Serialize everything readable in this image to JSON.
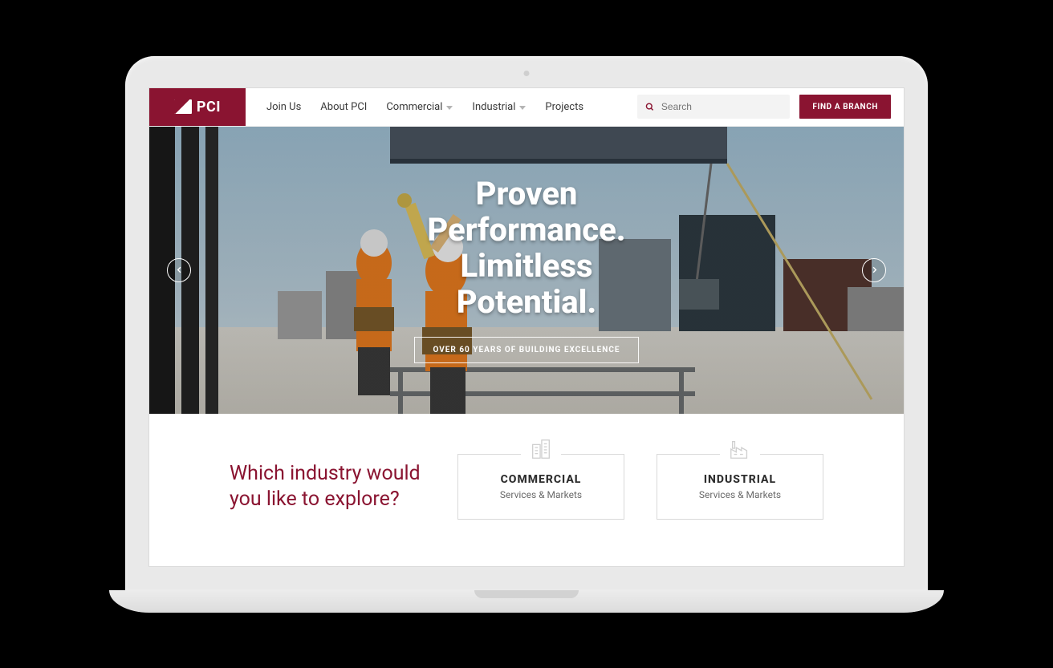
{
  "brand": {
    "name": "PCI"
  },
  "nav": {
    "items": [
      {
        "label": "Join Us",
        "dropdown": false
      },
      {
        "label": "About PCI",
        "dropdown": false
      },
      {
        "label": "Commercial",
        "dropdown": true
      },
      {
        "label": "Industrial",
        "dropdown": true
      },
      {
        "label": "Projects",
        "dropdown": false
      }
    ]
  },
  "search": {
    "placeholder": "Search"
  },
  "cta": {
    "find_branch": "FIND A BRANCH"
  },
  "hero": {
    "title_line1": "Proven",
    "title_line2": "Performance.",
    "title_line3": "Limitless",
    "title_line4": "Potential.",
    "subtitle_button": "OVER 60 YEARS OF BUILDING EXCELLENCE"
  },
  "industry": {
    "question": "Which industry would you like to explore?",
    "cards": [
      {
        "title": "COMMERCIAL",
        "subtitle": "Services & Markets"
      },
      {
        "title": "INDUSTRIAL",
        "subtitle": "Services & Markets"
      }
    ]
  },
  "colors": {
    "brand": "#8a1431"
  }
}
